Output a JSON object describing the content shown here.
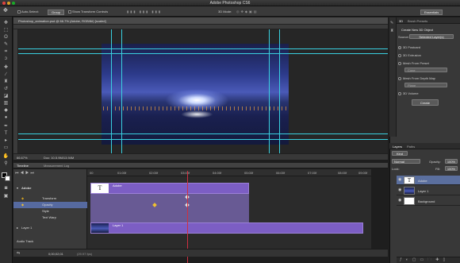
{
  "app": {
    "title": "Adobe Photoshop CS6"
  },
  "options_bar": {
    "auto_select_label": "Auto-Select:",
    "auto_select_value": "Group",
    "show_transform_label": "Show Transform Controls",
    "mode_3d_label": "3D Mode:",
    "workspace_label": "Essentials"
  },
  "document": {
    "tab_title": "Photoshop_animation.psd @ 66.7% (Adobe, RGB/8#) [scaled]",
    "zoom": "66.67%",
    "doc_size": "Doc: 10.5.9M/13.94M"
  },
  "timeline": {
    "panel_tabs": [
      "Timeline",
      "Measurement Log"
    ],
    "ruler_ticks": [
      "00",
      "01:00f",
      "02:00f",
      "03:00f",
      "04:00f",
      "05:00f",
      "06:00f",
      "07:00f",
      "08:00f",
      "09:00f"
    ],
    "layers": [
      {
        "name": "Adobe",
        "group": true
      },
      {
        "name": "Transform"
      },
      {
        "name": "Opacity",
        "selected": true
      },
      {
        "name": "Style"
      },
      {
        "name": "Text Warp"
      },
      {
        "name": "Layer 1",
        "group": true
      },
      {
        "name": "Audio Track"
      }
    ],
    "clips": [
      {
        "name": "Adobe",
        "thumb": "T"
      },
      {
        "name": "Layer 1"
      }
    ],
    "current_time": "0;00;02;01",
    "frame_rate": "(29.97 fps)"
  },
  "panels": {
    "top_tabs": [
      "3D"
    ],
    "brush_presets_tab": "Brush Presets",
    "create_title": "Create New 3D Object",
    "source_label": "Source:",
    "source_value": "Selected Layer(s)",
    "options": [
      {
        "label": "3D Postcard",
        "selected": true
      },
      {
        "label": "3D Extrusion"
      },
      {
        "label": "Mesh From Preset"
      },
      {
        "label": "Cone",
        "dropdown": true
      },
      {
        "label": "Mesh From Depth Map"
      },
      {
        "label": "Plane",
        "dropdown": true
      },
      {
        "label": "3D Volume"
      }
    ],
    "create_button": "Create",
    "layer_tabs": [
      "Layers",
      "Paths"
    ],
    "kind_label": "Kind",
    "blend_mode": "Normal",
    "opacity_label": "Opacity:",
    "opacity_value": "100%",
    "lock_label": "Lock:",
    "fill_label": "Fill:",
    "fill_value": "100%",
    "layers": [
      {
        "name": "Adobe",
        "selected": true
      },
      {
        "name": "Layer 1"
      },
      {
        "name": "Background"
      }
    ]
  }
}
